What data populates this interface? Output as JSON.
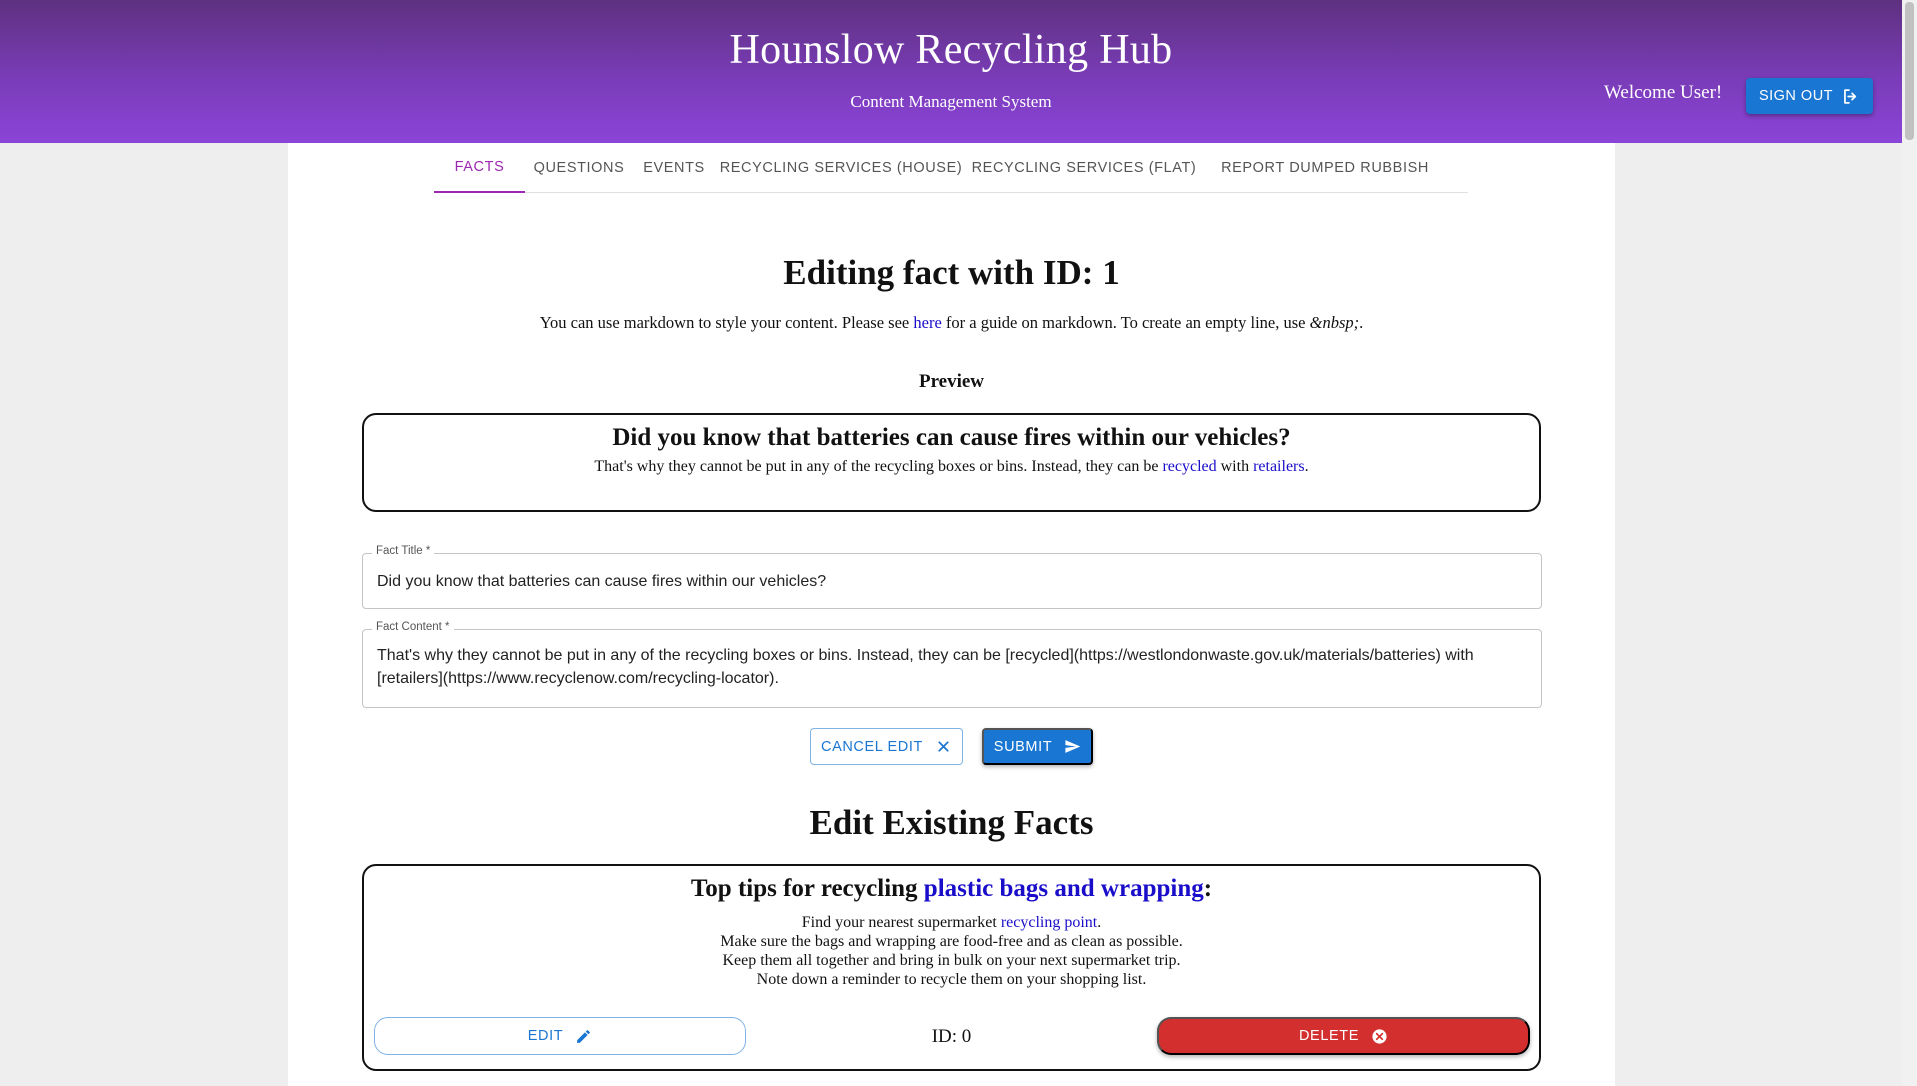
{
  "header": {
    "title": "Hounslow Recycling Hub",
    "subtitle": "Content Management System",
    "welcome": "Welcome User!",
    "signout_label": "SIGN OUT"
  },
  "tabs": [
    {
      "label": "FACTS",
      "active": true
    },
    {
      "label": "QUESTIONS"
    },
    {
      "label": "EVENTS"
    },
    {
      "label": "RECYCLING SERVICES (HOUSE)"
    },
    {
      "label": "RECYCLING SERVICES (FLAT)"
    },
    {
      "label": "REPORT DUMPED RUBBISH"
    }
  ],
  "editor": {
    "heading": "Editing fact with ID: 1",
    "hint_before": "You can use markdown to style your content. Please see ",
    "hint_link": "here",
    "hint_after": " for a guide on markdown. To create an empty line, use ",
    "hint_code": "&nbsp;",
    "hint_end": ".",
    "preview_label": "Preview",
    "preview": {
      "title": "Did you know that batteries can cause fires within our vehicles?",
      "text_before": "That's why they cannot be put in any of the recycling boxes or bins. Instead, they can be ",
      "link1": "recycled",
      "text_mid": " with ",
      "link2": "retailers",
      "text_end": "."
    },
    "title_field": {
      "label": "Fact Title *",
      "value": "Did you know that batteries can cause fires within our vehicles?"
    },
    "content_field": {
      "label": "Fact Content *",
      "value": "That's why they cannot be put in any of the recycling boxes or bins. Instead, they can be [recycled](https://westlondonwaste.gov.uk/materials/batteries) with [retailers](https://www.recyclenow.com/recycling-locator)."
    },
    "cancel_label": "CANCEL EDIT",
    "submit_label": "SUBMIT"
  },
  "existing": {
    "heading": "Edit Existing Facts",
    "facts": [
      {
        "title_before": "Top tips for recycling ",
        "title_link": "plastic bags and wrapping",
        "title_after": ":",
        "line1_before": "Find your nearest supermarket ",
        "line1_link": "recycling point",
        "line1_after": ".",
        "line2": "Make sure the bags and wrapping are food-free and as clean as possible.",
        "line3": "Keep them all together and bring in bulk on your next supermarket trip.",
        "line4": "Note down a reminder to recycle them on your shopping list.",
        "edit_label": "EDIT",
        "id_label": "ID: 0",
        "delete_label": "DELETE"
      }
    ]
  },
  "colors": {
    "header_gradient_top": "#5e3180",
    "header_gradient_bottom": "#8b44d8",
    "primary": "#1976d2",
    "active_tab": "#9c27b0",
    "delete": "#d32f2f",
    "link": "#1a0dca"
  }
}
